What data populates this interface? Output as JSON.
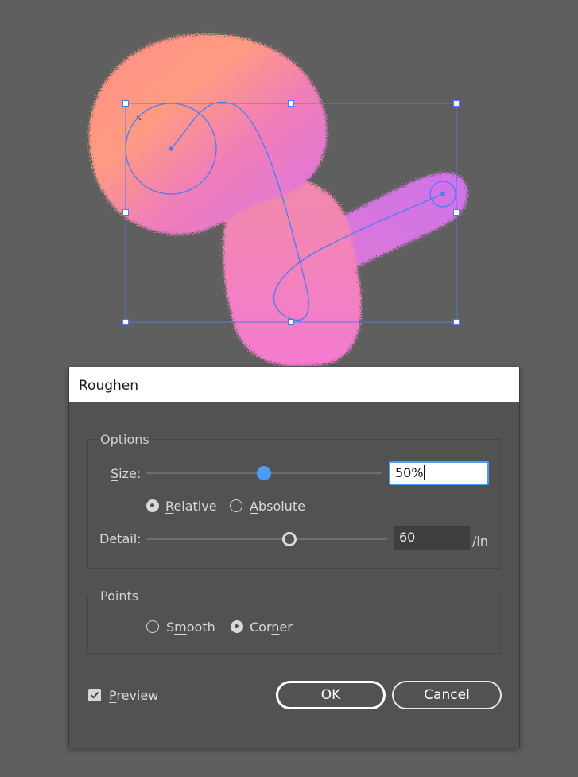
{
  "dialog": {
    "title": "Roughen",
    "options_group": {
      "title": "Options",
      "size_label": "Size:",
      "size_value": "50%",
      "size_fraction": 0.5,
      "relative_label": "Relative",
      "absolute_label": "Absolute",
      "selected_mode": "Relative",
      "detail_label": "Detail:",
      "detail_value": "60",
      "detail_fraction": 0.6,
      "detail_unit": "/in"
    },
    "points_group": {
      "title": "Points",
      "smooth_label": "Smooth",
      "corner_label": "Corner",
      "selected": "Corner"
    },
    "preview_label": "Preview",
    "preview_checked": true,
    "ok_label": "OK",
    "cancel_label": "Cancel"
  },
  "colors": {
    "canvas_background": "#5f5f5f",
    "selection_blue": "#4a7bf2",
    "blob_orange": "#ff9f7a",
    "blob_pink": "#f472c8",
    "blob_purple": "#d270e8"
  }
}
